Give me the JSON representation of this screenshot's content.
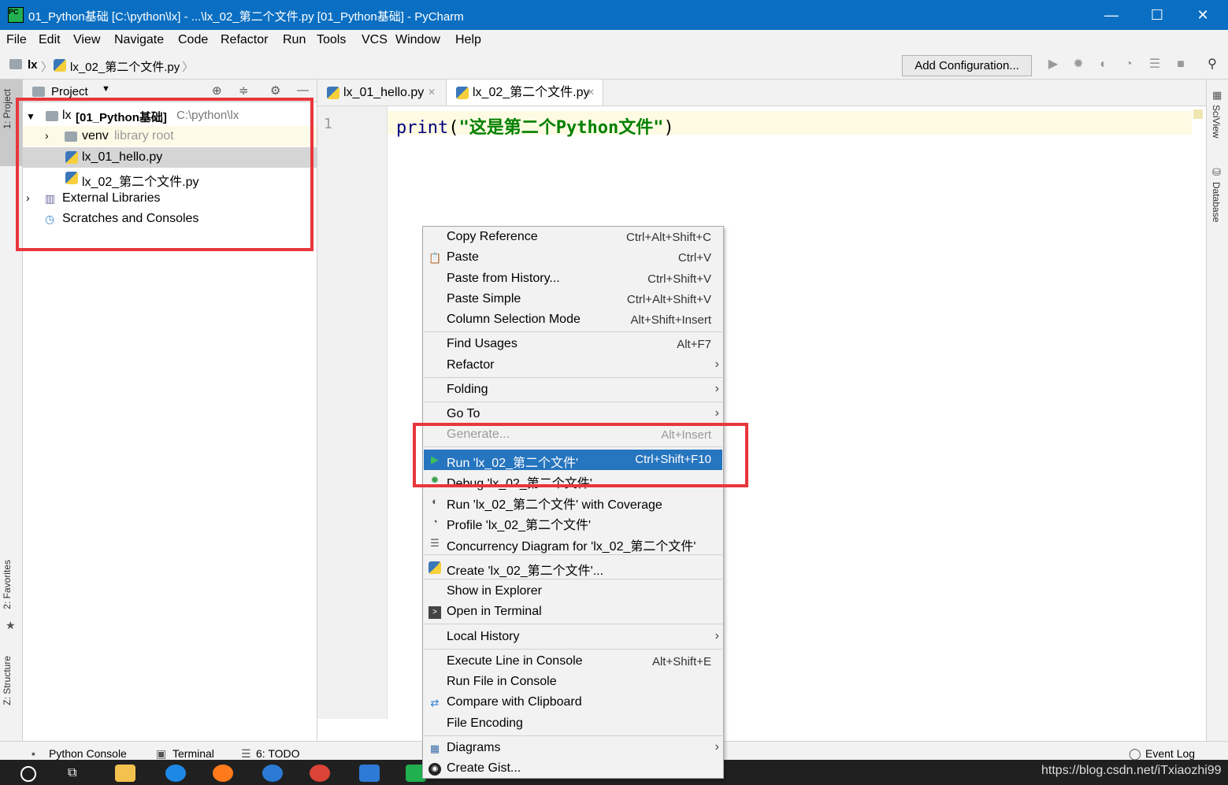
{
  "window": {
    "title": "01_Python基础 [C:\\python\\lx] - ...\\lx_02_第二个文件.py [01_Python基础] - PyCharm",
    "minimize": "—",
    "maximize": "☐",
    "close": "✕"
  },
  "menu": [
    "File",
    "Edit",
    "View",
    "Navigate",
    "Code",
    "Refactor",
    "Run",
    "Tools",
    "VCS",
    "Window",
    "Help"
  ],
  "navbar": {
    "crumb_root": "lx",
    "crumb_file": "lx_02_第二个文件.py",
    "add_config": "Add Configuration..."
  },
  "left_tabs": {
    "project": "1: Project",
    "favorites": "2: Favorites",
    "structure": "Z: Structure"
  },
  "right_tabs": {
    "sciview": "SciView",
    "database": "Database"
  },
  "project_panel": {
    "header": "Project",
    "root_name": "lx",
    "root_module": "[01_Python基础]",
    "root_path": "C:\\python\\lx",
    "venv": "venv",
    "venv_note": "library root",
    "file1": "lx_01_hello.py",
    "file2": "lx_02_第二个文件.py",
    "ext_libs": "External Libraries",
    "scratches": "Scratches and Consoles"
  },
  "editor": {
    "tab1": "lx_01_hello.py",
    "tab2": "lx_02_第二个文件.py",
    "line_number": "1",
    "code_func": "print",
    "code_open": "(",
    "code_string": "\"这是第二个Python文件\"",
    "code_close": ")"
  },
  "context_menu": [
    {
      "label": "Copy Reference",
      "shortcut": "Ctrl+Alt+Shift+C"
    },
    {
      "label": "Paste",
      "shortcut": "Ctrl+V"
    },
    {
      "label": "Paste from History...",
      "shortcut": "Ctrl+Shift+V"
    },
    {
      "label": "Paste Simple",
      "shortcut": "Ctrl+Alt+Shift+V"
    },
    {
      "label": "Column Selection Mode",
      "shortcut": "Alt+Shift+Insert"
    },
    {
      "label": "Find Usages",
      "shortcut": "Alt+F7"
    },
    {
      "label": "Refactor",
      "shortcut": ""
    },
    {
      "label": "Folding",
      "shortcut": ""
    },
    {
      "label": "Go To",
      "shortcut": ""
    },
    {
      "label": "Generate...",
      "shortcut": "Alt+Insert"
    },
    {
      "label": "Run 'lx_02_第二个文件'",
      "shortcut": "Ctrl+Shift+F10"
    },
    {
      "label": "Debug 'lx_02_第二个文件'",
      "shortcut": ""
    },
    {
      "label": "Run 'lx_02_第二个文件' with Coverage",
      "shortcut": ""
    },
    {
      "label": "Profile 'lx_02_第二个文件'",
      "shortcut": ""
    },
    {
      "label": "Concurrency Diagram for 'lx_02_第二个文件'",
      "shortcut": ""
    },
    {
      "label": "Create 'lx_02_第二个文件'...",
      "shortcut": ""
    },
    {
      "label": "Show in Explorer",
      "shortcut": ""
    },
    {
      "label": "Open in Terminal",
      "shortcut": ""
    },
    {
      "label": "Local History",
      "shortcut": ""
    },
    {
      "label": "Execute Line in Console",
      "shortcut": "Alt+Shift+E"
    },
    {
      "label": "Run File in Console",
      "shortcut": ""
    },
    {
      "label": "Compare with Clipboard",
      "shortcut": ""
    },
    {
      "label": "File Encoding",
      "shortcut": ""
    },
    {
      "label": "Diagrams",
      "shortcut": ""
    },
    {
      "label": "Create Gist...",
      "shortcut": ""
    }
  ],
  "bottom_bar": {
    "python_console": "Python Console",
    "terminal": "Terminal",
    "todo": "6: TODO",
    "event_log": "Event Log"
  },
  "taskbar": {
    "watermark": "https://blog.csdn.net/iTxiaozhi99"
  },
  "colors": {
    "titlebar": "#0a6fc2",
    "selection": "#2675bf",
    "highlight_box": "#e8363b",
    "code_keyword": "#000080",
    "code_string": "#008000"
  }
}
